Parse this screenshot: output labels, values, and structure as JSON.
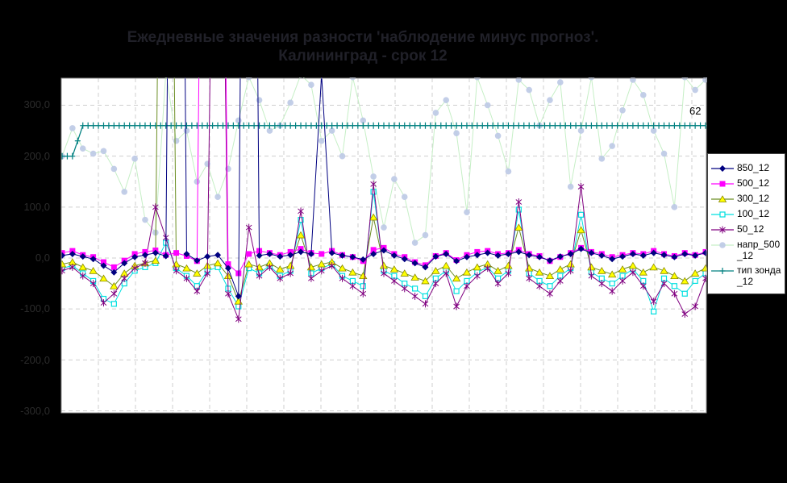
{
  "title": {
    "line1": "Ежедневные значения разности 'наблюдение минус прогноз'.",
    "line2": "Калининград - срок 12"
  },
  "y_axis": {
    "labels": [
      "300,0",
      "200,0",
      "100,0",
      "0,0",
      "-100,0",
      "-200,0",
      "-300,0"
    ]
  },
  "legend": {
    "items": [
      {
        "label": "850_12",
        "line_color": "#000080",
        "marker": "diamond",
        "marker_color": "#000080"
      },
      {
        "label": "500_12",
        "line_color": "#FF00FF",
        "marker": "square",
        "marker_color": "#FF00FF"
      },
      {
        "label": "300_12",
        "line_color": "#6B8E23",
        "marker": "triangle",
        "marker_color": "#FFFF00"
      },
      {
        "label": "100_12",
        "line_color": "#00E0E0",
        "marker": "open-square",
        "marker_color": "#00E0E0"
      },
      {
        "label": "50_12",
        "line_color": "#800080",
        "marker": "asterisk",
        "marker_color": "#800080"
      },
      {
        "label": "напр_500_12",
        "line_color": "#C6EFC6",
        "marker": "circle",
        "marker_color": "#BDC9E6"
      },
      {
        "label": "тип зонда_12",
        "line_color": "#008080",
        "marker": "plus",
        "marker_color": "#008080"
      }
    ]
  },
  "annotations": {
    "last_value_label": "62"
  },
  "colors": {
    "background": "#000000",
    "plot_background": "#FFFFFF",
    "gridline": "#CFCFCF",
    "plot_border": "#8F8F8F",
    "title_text": "#202028",
    "axis_text": "#2B2B2B"
  },
  "chart_data": {
    "type": "line",
    "title": "Ежедневные значения разности 'наблюдение минус прогноз'. Калининград - срок 12",
    "ylabel": "",
    "xlabel": "",
    "ylim": [
      -305,
      353
    ],
    "y_ticks": [
      300,
      200,
      100,
      0,
      -100,
      -200,
      -300
    ],
    "grid": true,
    "legend_position": "right",
    "x_count": 63,
    "series": [
      {
        "name": "850_12",
        "marker": "diamond",
        "line_color": "#000080",
        "marker_color": "#000080",
        "values": [
          5,
          8,
          3,
          -2,
          -15,
          -28,
          -10,
          2,
          6,
          10,
          4,
          2500,
          8,
          -5,
          3,
          6,
          -20,
          -75,
          2500,
          5,
          8,
          3,
          6,
          12,
          8,
          360,
          10,
          5,
          2,
          -3,
          8,
          15,
          5,
          -2,
          -10,
          -18,
          3,
          8,
          -6,
          2,
          6,
          10,
          5,
          8,
          12,
          6,
          2,
          -5,
          3,
          8,
          18,
          10,
          5,
          -2,
          3,
          8,
          5,
          10,
          6,
          2,
          8,
          5,
          10
        ]
      },
      {
        "name": "500_12",
        "marker": "square",
        "line_color": "#FF00FF",
        "marker_color": "#FF00FF",
        "values": [
          10,
          14,
          6,
          2,
          -8,
          -18,
          -5,
          8,
          12,
          15,
          6,
          10,
          4,
          -6,
          2000,
          1800,
          -12,
          -30,
          8,
          14,
          10,
          6,
          12,
          18,
          10,
          8,
          14,
          6,
          2,
          -6,
          16,
          20,
          8,
          2,
          -8,
          -14,
          4,
          10,
          -4,
          6,
          12,
          14,
          8,
          10,
          16,
          8,
          4,
          -6,
          2,
          10,
          20,
          12,
          8,
          2,
          6,
          10,
          8,
          14,
          8,
          4,
          10,
          6,
          12
        ]
      },
      {
        "name": "300_12",
        "marker": "triangle",
        "line_color": "#6B8E23",
        "marker_color": "#FFFF00",
        "values": [
          -12,
          -8,
          -18,
          -25,
          -40,
          -55,
          -30,
          -15,
          -10,
          -5,
          2000,
          -12,
          -20,
          -30,
          -15,
          -10,
          -35,
          -85,
          -12,
          -18,
          -10,
          -22,
          -15,
          45,
          -18,
          -12,
          -8,
          -20,
          -28,
          -35,
          80,
          -15,
          -22,
          -30,
          -38,
          -45,
          -25,
          -15,
          -40,
          -28,
          -18,
          -12,
          -25,
          -15,
          60,
          -20,
          -28,
          -35,
          -22,
          -12,
          55,
          -18,
          -25,
          -32,
          -22,
          -15,
          -28,
          -18,
          -25,
          -35,
          -45,
          -30,
          -20
        ]
      },
      {
        "name": "100_12",
        "marker": "open-square",
        "line_color": "#00E0E0",
        "marker_color": "#00E0E0",
        "values": [
          -20,
          -15,
          -30,
          -45,
          -80,
          -90,
          -50,
          -25,
          -18,
          -10,
          30,
          -20,
          -35,
          -55,
          -25,
          -18,
          -60,
          -95,
          -20,
          -30,
          -15,
          -35,
          -25,
          75,
          -30,
          -20,
          -12,
          -35,
          -45,
          -55,
          130,
          -25,
          -35,
          -50,
          -60,
          -75,
          -40,
          -25,
          -65,
          -45,
          -28,
          -18,
          -40,
          -25,
          95,
          -30,
          -45,
          -55,
          -35,
          -20,
          85,
          -28,
          -40,
          -50,
          -35,
          -22,
          -45,
          -105,
          -40,
          -55,
          -70,
          -45,
          -30
        ]
      },
      {
        "name": "50_12",
        "marker": "asterisk",
        "line_color": "#800080",
        "marker_color": "#800080",
        "values": [
          -25,
          -18,
          -35,
          -50,
          -88,
          -70,
          -40,
          -20,
          -10,
          100,
          40,
          -25,
          -40,
          -65,
          -30,
          1500,
          -70,
          -120,
          60,
          -35,
          -18,
          -40,
          -30,
          92,
          -40,
          -25,
          -15,
          -40,
          -55,
          -70,
          145,
          -30,
          -45,
          -60,
          -75,
          -90,
          -50,
          -30,
          -95,
          -55,
          -35,
          -20,
          -50,
          -30,
          110,
          -40,
          -55,
          -70,
          -45,
          -25,
          140,
          -35,
          -50,
          -65,
          -45,
          -28,
          -55,
          -85,
          -50,
          -70,
          -110,
          -95,
          -40
        ]
      },
      {
        "name": "напр_500_12",
        "marker": "circle",
        "line_color": "#C6EFC6",
        "marker_color": "#BDC9E6",
        "values": [
          200,
          255,
          215,
          205,
          210,
          175,
          130,
          195,
          75,
          50,
          365,
          230,
          250,
          150,
          185,
          120,
          175,
          270,
          355,
          310,
          250,
          260,
          305,
          360,
          340,
          230,
          250,
          200,
          355,
          270,
          160,
          60,
          155,
          120,
          30,
          45,
          285,
          310,
          245,
          90,
          355,
          300,
          240,
          170,
          350,
          330,
          260,
          310,
          345,
          140,
          250,
          355,
          195,
          220,
          290,
          350,
          320,
          250,
          205,
          100,
          355,
          330,
          350
        ]
      },
      {
        "name": "тип зонда_12",
        "marker": "plus",
        "line_color": "#008080",
        "marker_color": "#008080",
        "values": [
          200,
          200,
          260,
          260,
          260,
          260,
          260,
          260,
          260,
          260,
          260,
          260,
          260,
          260,
          260,
          260,
          260,
          260,
          260,
          260,
          260,
          260,
          260,
          260,
          260,
          260,
          260,
          260,
          260,
          260,
          260,
          260,
          260,
          260,
          260,
          260,
          260,
          260,
          260,
          260,
          260,
          260,
          260,
          260,
          260,
          260,
          260,
          260,
          260,
          260,
          260,
          260,
          260,
          260,
          260,
          260,
          260,
          260,
          260,
          260,
          260,
          260,
          260
        ],
        "end_label": "62"
      }
    ]
  }
}
